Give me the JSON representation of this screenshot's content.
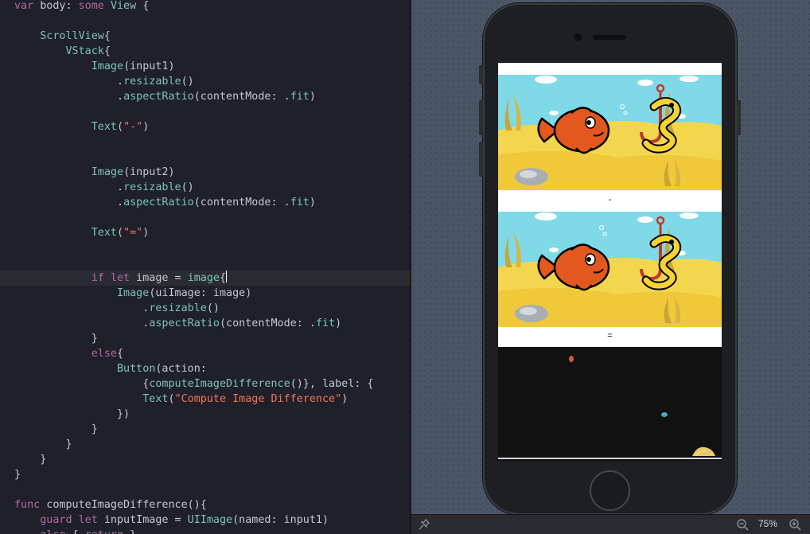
{
  "editor": {
    "current_line": 18,
    "lines": [
      [
        [
          "kw",
          "var"
        ],
        [
          "p",
          " body: "
        ],
        [
          "kw",
          "some"
        ],
        [
          "p",
          " "
        ],
        [
          "type",
          "View"
        ],
        [
          "p",
          " {"
        ]
      ],
      [],
      [
        [
          "p",
          "    "
        ],
        [
          "type",
          "ScrollView"
        ],
        [
          "p",
          "{"
        ]
      ],
      [
        [
          "p",
          "        "
        ],
        [
          "type",
          "VStack"
        ],
        [
          "p",
          "{"
        ]
      ],
      [
        [
          "p",
          "            "
        ],
        [
          "type",
          "Image"
        ],
        [
          "p",
          "(input1)"
        ]
      ],
      [
        [
          "p",
          "                ."
        ],
        [
          "mod",
          "resizable"
        ],
        [
          "p",
          "()"
        ]
      ],
      [
        [
          "p",
          "                ."
        ],
        [
          "mod",
          "aspectRatio"
        ],
        [
          "p",
          "(contentMode: ."
        ],
        [
          "mod",
          "fit"
        ],
        [
          "p",
          ")"
        ]
      ],
      [],
      [
        [
          "p",
          "            "
        ],
        [
          "type",
          "Text"
        ],
        [
          "p",
          "("
        ],
        [
          "str",
          "\"-\""
        ],
        [
          "p",
          ")"
        ]
      ],
      [],
      [],
      [
        [
          "p",
          "            "
        ],
        [
          "type",
          "Image"
        ],
        [
          "p",
          "(input2)"
        ]
      ],
      [
        [
          "p",
          "                ."
        ],
        [
          "mod",
          "resizable"
        ],
        [
          "p",
          "()"
        ]
      ],
      [
        [
          "p",
          "                ."
        ],
        [
          "mod",
          "aspectRatio"
        ],
        [
          "p",
          "(contentMode: ."
        ],
        [
          "mod",
          "fit"
        ],
        [
          "p",
          ")"
        ]
      ],
      [],
      [
        [
          "p",
          "            "
        ],
        [
          "type",
          "Text"
        ],
        [
          "p",
          "("
        ],
        [
          "str",
          "\"=\""
        ],
        [
          "p",
          ")"
        ]
      ],
      [],
      [],
      [
        [
          "p",
          "            "
        ],
        [
          "kw",
          "if"
        ],
        [
          "p",
          " "
        ],
        [
          "kw",
          "let"
        ],
        [
          "p",
          " image = "
        ],
        [
          "fn",
          "image"
        ],
        [
          "p",
          "{"
        ],
        [
          "caret",
          ""
        ]
      ],
      [
        [
          "p",
          "                "
        ],
        [
          "type",
          "Image"
        ],
        [
          "p",
          "(uiImage: image)"
        ]
      ],
      [
        [
          "p",
          "                    ."
        ],
        [
          "mod",
          "resizable"
        ],
        [
          "p",
          "()"
        ]
      ],
      [
        [
          "p",
          "                    ."
        ],
        [
          "mod",
          "aspectRatio"
        ],
        [
          "p",
          "(contentMode: ."
        ],
        [
          "mod",
          "fit"
        ],
        [
          "p",
          ")"
        ]
      ],
      [
        [
          "p",
          "            }"
        ]
      ],
      [
        [
          "p",
          "            "
        ],
        [
          "kw",
          "else"
        ],
        [
          "p",
          "{"
        ]
      ],
      [
        [
          "p",
          "                "
        ],
        [
          "type",
          "Button"
        ],
        [
          "p",
          "(action:"
        ]
      ],
      [
        [
          "p",
          "                    {"
        ],
        [
          "fn",
          "computeImageDifference"
        ],
        [
          "p",
          "()}, label: {"
        ]
      ],
      [
        [
          "p",
          "                    "
        ],
        [
          "type",
          "Text"
        ],
        [
          "p",
          "("
        ],
        [
          "str",
          "\"Compute Image Difference\""
        ],
        [
          "p",
          ")"
        ]
      ],
      [
        [
          "p",
          "                })"
        ]
      ],
      [
        [
          "p",
          "            }"
        ]
      ],
      [
        [
          "p",
          "        }"
        ]
      ],
      [
        [
          "p",
          "    }"
        ]
      ],
      [
        [
          "p",
          "}"
        ]
      ],
      [],
      [
        [
          "kw",
          "func"
        ],
        [
          "p",
          " computeImageDifference(){"
        ]
      ],
      [
        [
          "p",
          "    "
        ],
        [
          "kw",
          "guard"
        ],
        [
          "p",
          " "
        ],
        [
          "kw",
          "let"
        ],
        [
          "p",
          " inputImage = "
        ],
        [
          "type",
          "UIImage"
        ],
        [
          "p",
          "(named: input1)"
        ]
      ],
      [
        [
          "p",
          "    "
        ],
        [
          "kw",
          "else"
        ],
        [
          "p",
          " { "
        ],
        [
          "kw",
          "return"
        ],
        [
          "p",
          " }"
        ]
      ]
    ]
  },
  "preview": {
    "minus_label": "-",
    "equals_label": "=",
    "zoom_label": "75%"
  },
  "icons": {
    "pin": "pin-icon",
    "zoom_out": "zoom-out-icon",
    "zoom_in": "zoom-in-icon"
  },
  "colors": {
    "keyword": "#b068a6",
    "type": "#7dc4b8",
    "string": "#f0765a",
    "plain": "#c5c8d1",
    "editor_bg": "#1f2029",
    "canvas_bg": "#4a5566"
  }
}
